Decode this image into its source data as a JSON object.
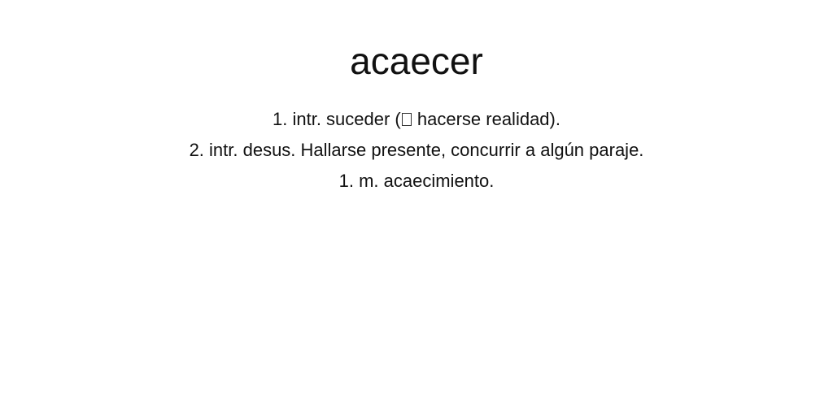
{
  "entry": {
    "word": "acaecer"
  },
  "definitions": [
    {
      "before_symbol": "1. intr. suceder (",
      "symbol_icon": "missing-glyph-box-icon",
      "after_symbol": " hacerse realidad)."
    },
    {
      "text": "2. intr. desus. Hallarse presente, concurrir a algún paraje."
    },
    {
      "text": "1. m. acaecimiento."
    }
  ]
}
